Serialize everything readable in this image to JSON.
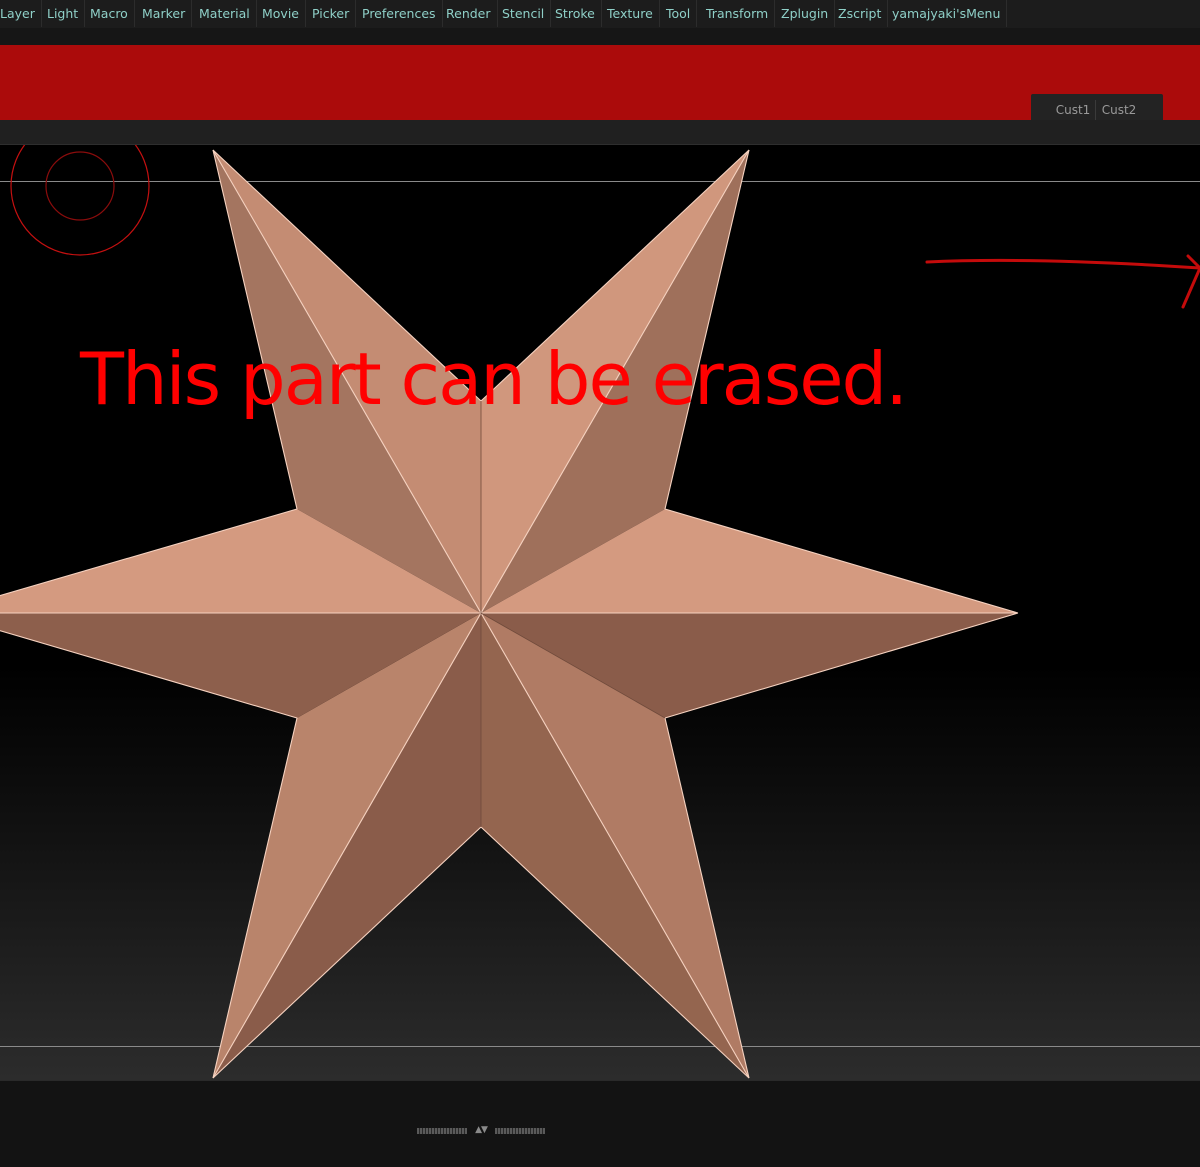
{
  "menubar": {
    "items": [
      {
        "label": "Layer"
      },
      {
        "label": "Light"
      },
      {
        "label": "Macro"
      },
      {
        "label": "Marker"
      },
      {
        "label": "Material"
      },
      {
        "label": "Movie"
      },
      {
        "label": "Picker"
      },
      {
        "label": "Preferences"
      },
      {
        "label": "Render"
      },
      {
        "label": "Stencil"
      },
      {
        "label": "Stroke"
      },
      {
        "label": "Texture"
      },
      {
        "label": "Tool"
      },
      {
        "label": "Transform"
      },
      {
        "label": "Zplugin"
      },
      {
        "label": "Zscript"
      },
      {
        "label": "yamajyaki'sMenu"
      }
    ]
  },
  "custom_tabs": {
    "cust1_label": "Cust1",
    "cust2_label": "Cust2"
  },
  "annotation": {
    "text": "This part can be erased.",
    "color": "#ff0000"
  },
  "colors": {
    "menu_text": "#8fd0c8",
    "annotation_band": "#ab0b0b",
    "star_light": "#d49a80",
    "star_dark": "#8a5c4a"
  },
  "icons": {
    "brush_cursor": "brush-circle-icon",
    "tray_handle": "resize-handle-icon"
  }
}
